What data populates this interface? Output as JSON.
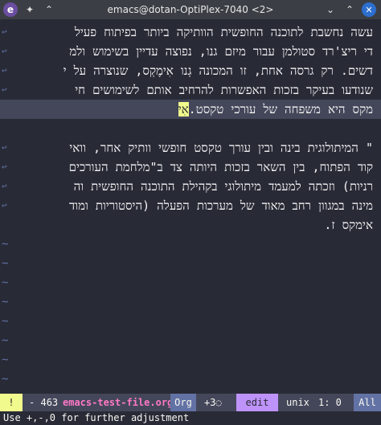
{
  "window": {
    "title": "emacs@dotan-OptiPlex-7040 <2>",
    "app_icon": "emacs-icon",
    "app_icon_glyph": "e",
    "pin_icon": "pin-icon",
    "keep_above_icon": "chevron-up-icon",
    "minimize_icon": "chevron-down-icon",
    "maximize_icon": "chevron-up-icon",
    "close_icon": "close-icon"
  },
  "buffer": {
    "lines": [
      "עשה נחשבת לתוכנה החופשית הוותיקה ביותר בפיתוח פעיל",
      "די ריצ'רד סטולמן עבור מיזם גנו, נפוצה עדיין בשימוש ולמ",
      "דשים. רק גרסה אחת, זו המכונה גְנו אִימֶקְס, שנוצרה על י",
      "שנודעו בעיקר בזכות האפשרות להרחיב אותם לשימושים חי",
      "מקס היא משפחה של עורכי טקסט.",
      "",
      "\" המיתולוגית בינה ובין עורך טקסט חופשי וותיק אחר, וואי",
      "קוד הפתוח, בין השאר בזכות היותה צד ב\"מלחמת העורכים",
      "רניות) וזכתה למעמד מיתולוגי בקהילת התוכנה החופשית וה",
      "מינה במגוון רחב מאוד של מערכות הפעלה (היסטוריות ומוד",
      "אימקס ז."
    ],
    "cursor_char": "אִי",
    "tilde": "~"
  },
  "modeline": {
    "warning": "!",
    "separator": "-",
    "size": "463",
    "filename": "emacs-test-file.org",
    "major_mode": "Org",
    "vc_status": "+3",
    "vc_icon": "◌",
    "evil_state": "edit",
    "encoding": "unix",
    "position": "1: 0",
    "percent": "All"
  },
  "echo_area": {
    "message": "Use +,-,0 for further adjustment"
  },
  "colors": {
    "background": "#282a36",
    "cursor": "#f1fa8c",
    "filename": "#ff79c6",
    "evil_state": "#bd93f9",
    "tilde": "#6272a4"
  }
}
